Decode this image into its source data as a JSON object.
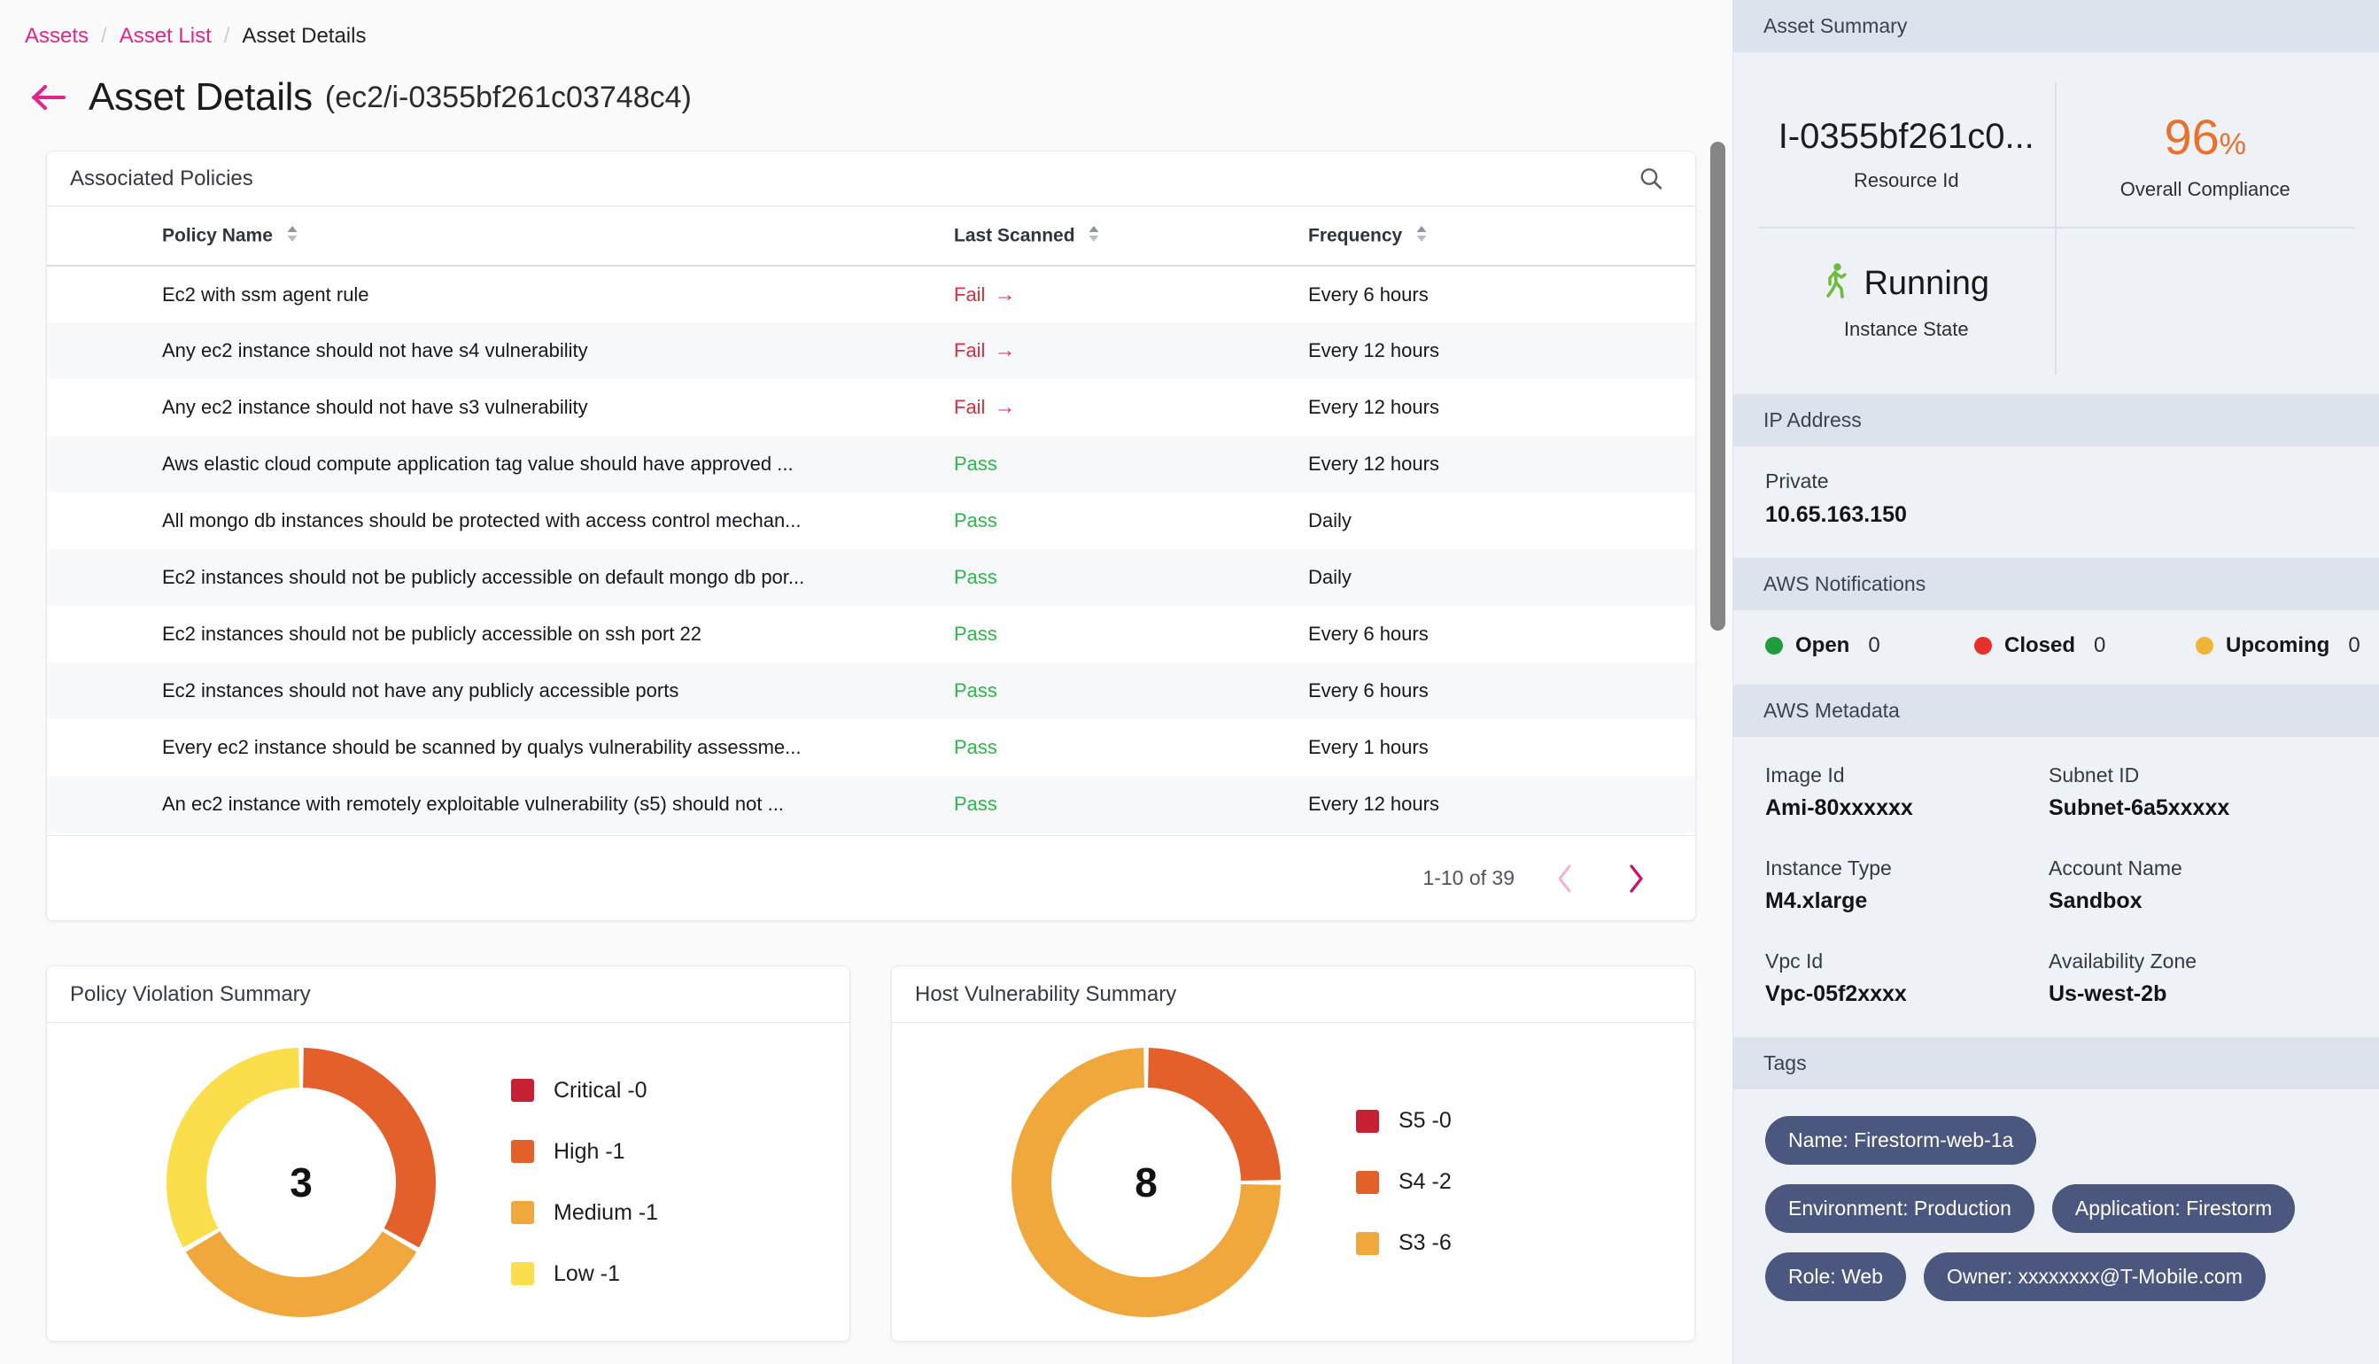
{
  "breadcrumb": {
    "items": [
      {
        "label": "Assets",
        "link": true
      },
      {
        "label": "Asset List",
        "link": true
      },
      {
        "label": "Asset Details",
        "link": false
      }
    ],
    "separator": "/"
  },
  "header": {
    "back_icon": "arrow-left-icon",
    "title": "Asset Details",
    "subtitle": "(ec2/i-0355bf261c03748c4)"
  },
  "policies_card": {
    "title": "Associated Policies",
    "search_icon": "search-icon",
    "columns": [
      {
        "label": "Policy Name",
        "sortable": true
      },
      {
        "label": "Last Scanned",
        "sortable": true
      },
      {
        "label": "Frequency",
        "sortable": true
      }
    ],
    "rows": [
      {
        "name": "Ec2 with ssm agent rule",
        "status": "Fail",
        "frequency": "Every 6 hours"
      },
      {
        "name": "Any ec2 instance should not have s4 vulnerability",
        "status": "Fail",
        "frequency": "Every 12 hours"
      },
      {
        "name": "Any ec2 instance should not have s3 vulnerability",
        "status": "Fail",
        "frequency": "Every 12 hours"
      },
      {
        "name": "Aws elastic cloud compute application tag value should have approved ...",
        "status": "Pass",
        "frequency": "Every 12 hours"
      },
      {
        "name": "All mongo db instances should be protected with access control mechan...",
        "status": "Pass",
        "frequency": "Daily"
      },
      {
        "name": "Ec2 instances should not be publicly accessible on default mongo db por...",
        "status": "Pass",
        "frequency": "Daily"
      },
      {
        "name": "Ec2 instances should not be publicly accessible on ssh port 22",
        "status": "Pass",
        "frequency": "Every 6 hours"
      },
      {
        "name": "Ec2 instances should not have any publicly accessible ports",
        "status": "Pass",
        "frequency": "Every 6 hours"
      },
      {
        "name": "Every ec2 instance should be scanned by qualys vulnerability assessme...",
        "status": "Pass",
        "frequency": "Every 1 hours"
      },
      {
        "name": "An ec2 instance with remotely exploitable vulnerability (s5) should not ...",
        "status": "Pass",
        "frequency": "Every 12 hours"
      }
    ],
    "pagination": {
      "range_text": "1-10 of 39",
      "prev_icon": "chevron-left-icon",
      "next_icon": "chevron-right-icon"
    },
    "status_colors": {
      "fail": "#d9303e",
      "pass": "#2eb44c",
      "fail_arrow": "#e2258c"
    }
  },
  "chart_data": [
    {
      "type": "pie",
      "title": "Policy Violation Summary",
      "center_value": "3",
      "categories": [
        "Critical",
        "High",
        "Medium",
        "Low"
      ],
      "values": [
        0,
        1,
        1,
        1
      ],
      "colors": [
        "#C62132",
        "#E4602B",
        "#F0A73C",
        "#FADE4B"
      ],
      "legend": [
        "Critical -0",
        "High -1",
        "Medium -1",
        "Low -1"
      ],
      "legend_position": "right",
      "donut": true
    },
    {
      "type": "pie",
      "title": "Host Vulnerability Summary",
      "center_value": "8",
      "categories": [
        "S5",
        "S4",
        "S3"
      ],
      "values": [
        0,
        2,
        6
      ],
      "colors": [
        "#C62132",
        "#E4602B",
        "#F0A73C"
      ],
      "legend": [
        "S5 -0",
        "S4 -2",
        "S3 -6"
      ],
      "legend_position": "right",
      "donut": true
    }
  ],
  "sidebar": {
    "asset_summary": {
      "heading": "Asset Summary",
      "resource_id_value": "I-0355bf261c0...",
      "resource_id_label": "Resource Id",
      "compliance_value": "96",
      "compliance_unit": "%",
      "compliance_label": "Overall Compliance",
      "instance_state_icon": "running-person-icon",
      "instance_state_value": "Running",
      "instance_state_label": "Instance State",
      "compliance_color": "#e8722c",
      "running_color": "#6cbd3a"
    },
    "ip_address": {
      "heading": "IP Address",
      "label": "Private",
      "value": "10.65.163.150"
    },
    "aws_notifications": {
      "heading": "AWS Notifications",
      "items": [
        {
          "label": "Open",
          "count": "0",
          "color": "#1f9c3c"
        },
        {
          "label": "Closed",
          "count": "0",
          "color": "#e8302a"
        },
        {
          "label": "Upcoming",
          "count": "0",
          "color": "#f2b434"
        }
      ]
    },
    "aws_metadata": {
      "heading": "AWS Metadata",
      "fields": [
        {
          "label": "Image Id",
          "value": "Ami-80xxxxxx"
        },
        {
          "label": "Subnet ID",
          "value": "Subnet-6a5xxxxx"
        },
        {
          "label": "Instance Type",
          "value": "M4.xlarge"
        },
        {
          "label": "Account Name",
          "value": "Sandbox"
        },
        {
          "label": "Vpc Id",
          "value": "Vpc-05f2xxxx"
        },
        {
          "label": "Availability Zone",
          "value": "Us-west-2b"
        }
      ]
    },
    "tags": {
      "heading": "Tags",
      "chips": [
        "Name: Firestorm-web-1a",
        "Environment: Production",
        "Application: Firestorm",
        "Role: Web",
        "Owner: xxxxxxxx@T-Mobile.com"
      ],
      "chip_color": "#4b577e"
    }
  }
}
